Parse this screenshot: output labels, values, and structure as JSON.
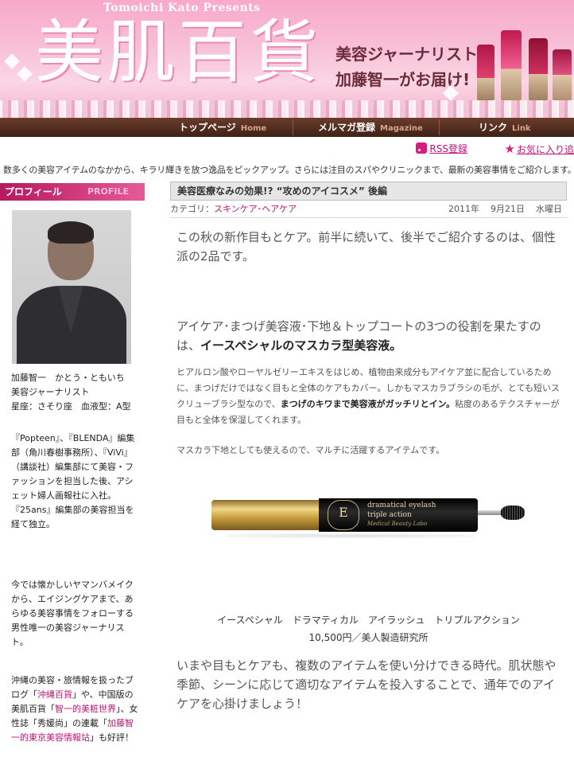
{
  "header": {
    "presents": "Tomoichi Kato Presents",
    "logo": "美肌百貨",
    "tagline_1": "美容ジャーナリスト",
    "tagline_2": "加藤智一がお届け!"
  },
  "nav": [
    {
      "label": "トップページ",
      "en": "Home"
    },
    {
      "label": "メルマガ登録",
      "en": "Magazine"
    },
    {
      "label": "リンク",
      "en": "Link"
    }
  ],
  "util": {
    "rss": "RSS登録",
    "favorite": "お気に入り追"
  },
  "intro": "数多くの美容アイテムのなかから、キラリ輝きを放つ逸品をピックアップ。さらには注目のスパやクリニックまで、最新の美容事情をご紹介します。",
  "profile": {
    "title": "プロフィール",
    "title_en": "PROFILE",
    "name_line": "加藤智一　かとう・ともいち",
    "job_line": "美容ジャーナリスト",
    "sign_line": "星座：さそり座　血液型：A型",
    "bio1": "『Popteen』、『BLENDA』編集部（角川春樹事務所）、『ViVi』（講談社）編集部にて美容・ファッションを担当した後、アシェット婦人画報社に入社。『25ans』編集部の美容担当を経て独立。",
    "bio2": "今では懐かしいヤマンバメイクから、エイジングケアまで、あらゆる美容事情をフォローする男性唯一の美容ジャーナリスト。",
    "bio3_a": "沖縄の美容・旅情報を扱ったブログ「",
    "bio3_link1": "沖縄百貨",
    "bio3_b": "」や、中国版の美肌百貨「",
    "bio3_link2": "智一的美粧世界",
    "bio3_c": "」、女性誌「秀媛尚」の連載「",
    "bio3_link3": "加藤智一的東京美容情報站",
    "bio3_d": "」も好評！"
  },
  "article": {
    "title": "美容医療なみの効果!? “攻めのアイコスメ” 後編",
    "category_label": "カテゴリ：",
    "category": "スキンケア･ヘアケア",
    "year": "2011年",
    "date": "9月21日",
    "weekday": "水曜日",
    "lead": "この秋の新作目もとケア。前半に続いて、後半でご紹介するのは、個性派の2品です。",
    "sub_lead_a": "アイケア･まつげ美容液･下地＆トップコートの3つの役割を果たすのは、",
    "sub_lead_b": "イースペシャルのマスカラ型美容液。",
    "body1_a": "ヒアルロン酸やローヤルゼリーエキスをはじめ、植物由来成分もアイケア並に配合しているために、まつげだけではなく目もと全体のケアもカバー。しかもマスカラブラシの毛が、とても短いスクリューブラシ型なので、",
    "body1_b": "まつげのキワまで美容液がガッチリとイン。",
    "body1_c": "粘度のあるテクスチャーが目もと全体を保湿してくれます。",
    "body2": "マスカラ下地としても使えるので、マルチに活躍するアイテムです。",
    "product_label_1": "dramatical eyelash",
    "product_label_2": "triple action",
    "product_label_3": "Medical Beauty Labo",
    "product_mark": "E",
    "caption_1": "イースペシャル　ドラマティカル　アイラッシュ　トリプルアクション",
    "caption_2": "10,500円／美人製造研究所",
    "closing": "いまや目もとケアも、複数のアイテムを使い分けできる時代。肌状態や季節、シーンに応じて適切なアイテムを投入することで、通年でのアイケアを心掛けましょう！"
  },
  "colors": {
    "accent": "#c0127a",
    "banner_pink": "#f7c0d6",
    "nav_brown": "#4a271b"
  }
}
